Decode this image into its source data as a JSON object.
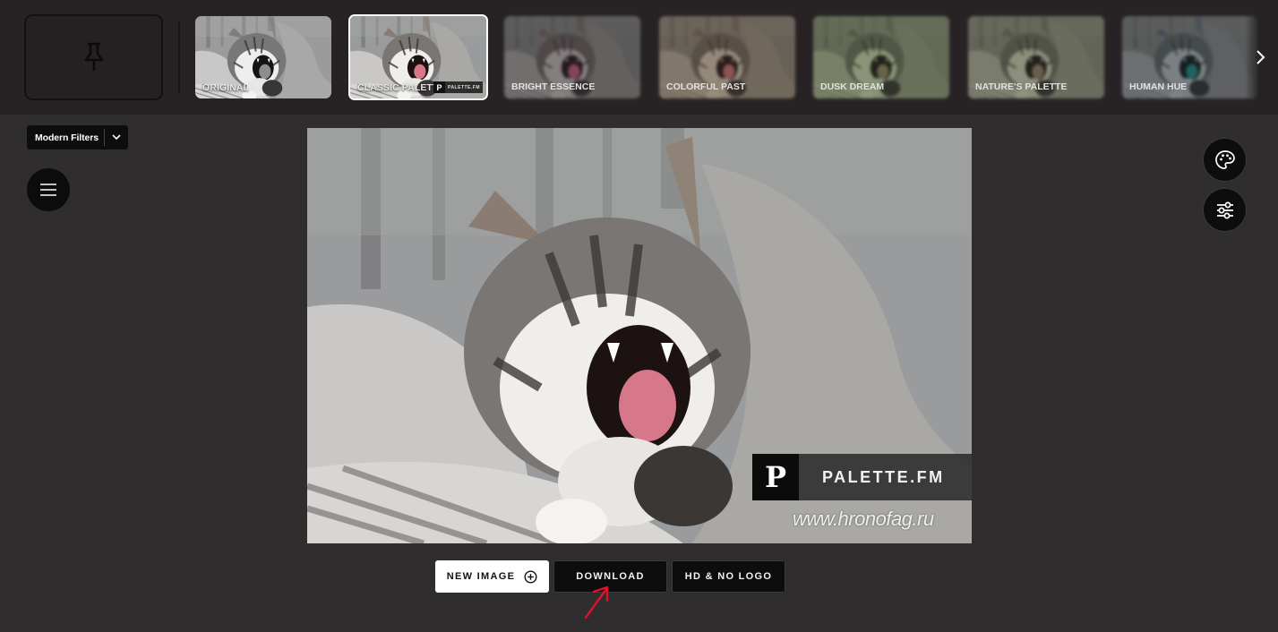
{
  "filter_strip": {
    "pin_icon": "pin-icon",
    "thumbnails": [
      {
        "label": "ORIGINAL",
        "active": false
      },
      {
        "label": "CLASSIC PALETTE",
        "active": true,
        "logo_letter": "P",
        "logo_text": "PALETTE.FM"
      },
      {
        "label": "BRIGHT ESSENCE",
        "active": false
      },
      {
        "label": "COLORFUL PAST",
        "active": false
      },
      {
        "label": "DUSK DREAM",
        "active": false
      },
      {
        "label": "NATURE'S PALETTE",
        "active": false
      },
      {
        "label": "HUMAN HUE",
        "active": false
      }
    ],
    "next_icon": "chevron-right-icon"
  },
  "left_panel": {
    "filter_select": {
      "value": "Modern Filters",
      "icon": "chevron-down-icon"
    },
    "menu_icon": "hamburger-menu-icon"
  },
  "right_panel": {
    "palette_icon": "palette-icon",
    "adjust_icon": "sliders-icon"
  },
  "image": {
    "watermark_letter": "P",
    "watermark_text": "PALETTE.FM",
    "watermark_url": "www.hronofag.ru"
  },
  "actions": {
    "new_image": "NEW IMAGE",
    "download": "DOWNLOAD",
    "hd": "HD & NO LOGO"
  },
  "colors": {
    "background": "#2f2d2e",
    "topbar": "#272324",
    "button_dark": "#0e0d0d",
    "annotation": "#e0102a"
  }
}
